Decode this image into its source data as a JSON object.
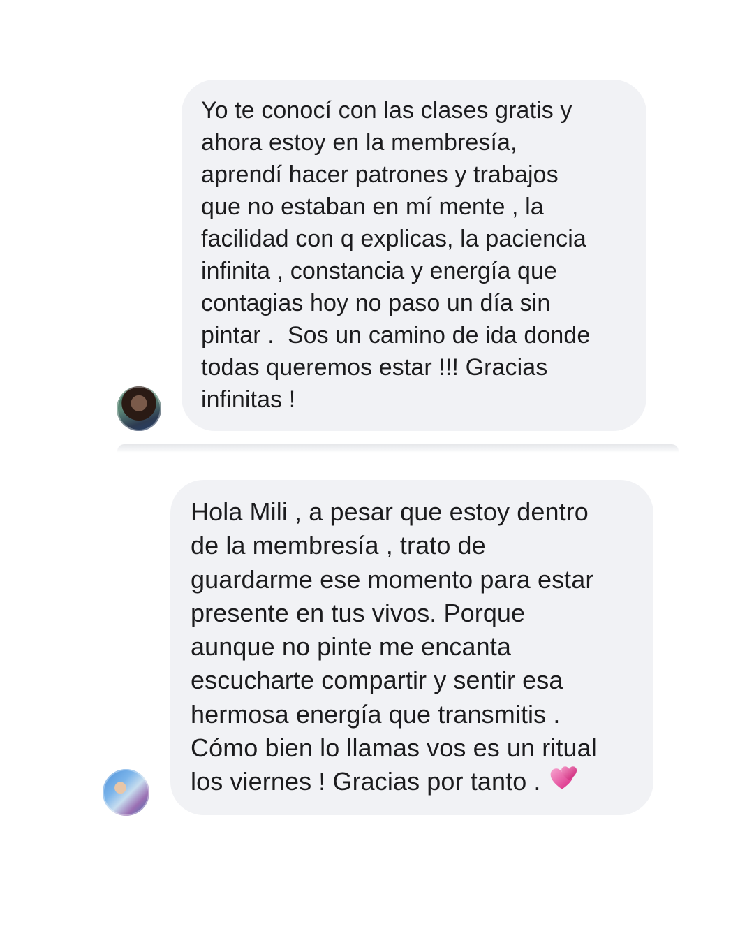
{
  "messages": [
    {
      "lines": [
        "Yo te conocí con las clases gratis y",
        "ahora estoy en la membresía,",
        "aprendí hacer patrones y trabajos",
        "que no estaban en mí mente , la",
        "facilidad con q explicas, la paciencia",
        "infinita , constancia y energía que",
        "contagias hoy no paso un día sin",
        "pintar .  Sos un camino de ida donde",
        "todas queremos estar !!! Gracias",
        "infinitas !"
      ],
      "avatar_icon": "user-avatar-photo"
    },
    {
      "lines": [
        "Hola Mili , a pesar que estoy dentro",
        "de la membresía , trato de",
        "guardarme ese momento para estar",
        "presente en tus vivos. Porque",
        "aunque no pinte me encanta",
        "escucharte compartir y sentir esa",
        "hermosa energía que transmitis .",
        "Cómo bien lo llamas vos es un ritual",
        "los viernes ! Gracias por tanto . "
      ],
      "emoji": "two-hearts-icon",
      "avatar_icon": "user-avatar-photo"
    }
  ],
  "colors": {
    "bubble_background": "#f1f2f5",
    "text": "#1c1c1e",
    "emoji_pink": "#e0348a"
  }
}
